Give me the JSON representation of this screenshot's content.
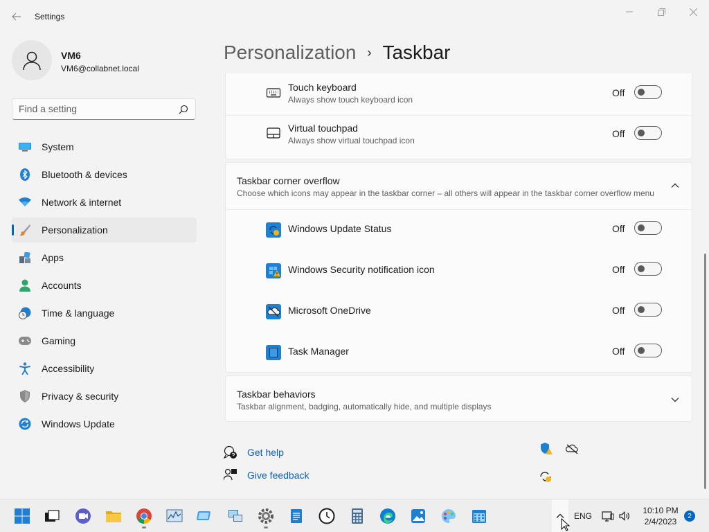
{
  "window": {
    "title": "Settings"
  },
  "colors": {
    "accent": "#0067c0",
    "link": "#0a5fb4",
    "background": "#f3f3f3",
    "card": "#fbfbfb"
  },
  "profile": {
    "name": "VM6",
    "email": "VM6@collabnet.local"
  },
  "search": {
    "placeholder": "Find a setting"
  },
  "sidebar": {
    "items": [
      {
        "label": "System",
        "icon": "monitor-icon",
        "active": false
      },
      {
        "label": "Bluetooth & devices",
        "icon": "bluetooth-icon",
        "active": false
      },
      {
        "label": "Network & internet",
        "icon": "wifi-icon",
        "active": false
      },
      {
        "label": "Personalization",
        "icon": "paintbrush-icon",
        "active": true
      },
      {
        "label": "Apps",
        "icon": "apps-icon",
        "active": false
      },
      {
        "label": "Accounts",
        "icon": "person-icon",
        "active": false
      },
      {
        "label": "Time & language",
        "icon": "clock-globe-icon",
        "active": false
      },
      {
        "label": "Gaming",
        "icon": "gamepad-icon",
        "active": false
      },
      {
        "label": "Accessibility",
        "icon": "accessibility-icon",
        "active": false
      },
      {
        "label": "Privacy & security",
        "icon": "shield-icon",
        "active": false
      },
      {
        "label": "Windows Update",
        "icon": "update-icon",
        "active": false
      }
    ]
  },
  "breadcrumb": {
    "parent": "Personalization",
    "separator": "›",
    "current": "Taskbar"
  },
  "pen_section": {
    "rows": [
      {
        "title": "Touch keyboard",
        "desc": "Always show touch keyboard icon",
        "state": "Off",
        "icon": "keyboard-icon"
      },
      {
        "title": "Virtual touchpad",
        "desc": "Always show virtual touchpad icon",
        "state": "Off",
        "icon": "touchpad-icon"
      }
    ]
  },
  "overflow_section": {
    "title": "Taskbar corner overflow",
    "desc": "Choose which icons may appear in the taskbar corner – all others will appear in the taskbar corner overflow menu",
    "rows": [
      {
        "title": "Windows Update Status",
        "state": "Off",
        "icon": "windows-update-status-icon"
      },
      {
        "title": "Windows Security notification icon",
        "state": "Off",
        "icon": "windows-security-icon"
      },
      {
        "title": "Microsoft OneDrive",
        "state": "Off",
        "icon": "onedrive-icon"
      },
      {
        "title": "Task Manager",
        "state": "Off",
        "icon": "task-manager-icon"
      }
    ]
  },
  "behaviors_section": {
    "title": "Taskbar behaviors",
    "desc": "Taskbar alignment, badging, automatically hide, and multiple displays"
  },
  "help_links": {
    "get_help": "Get help",
    "give_feedback": "Give feedback"
  },
  "taskbar": {
    "apps": [
      "start-icon",
      "task-view-icon",
      "teams-chat-icon",
      "file-explorer-icon",
      "chrome-icon",
      "resource-monitor-icon",
      "remote-desktop-icon",
      "network-connections-icon",
      "settings-icon",
      "notepad-icon",
      "clock-app-icon",
      "calculator-icon",
      "edge-icon",
      "photos-icon",
      "paint-icon",
      "calendar-icon"
    ],
    "tray": {
      "language": "ENG",
      "time": "10:10 PM",
      "date": "2/4/2023",
      "notifications": "2"
    }
  }
}
